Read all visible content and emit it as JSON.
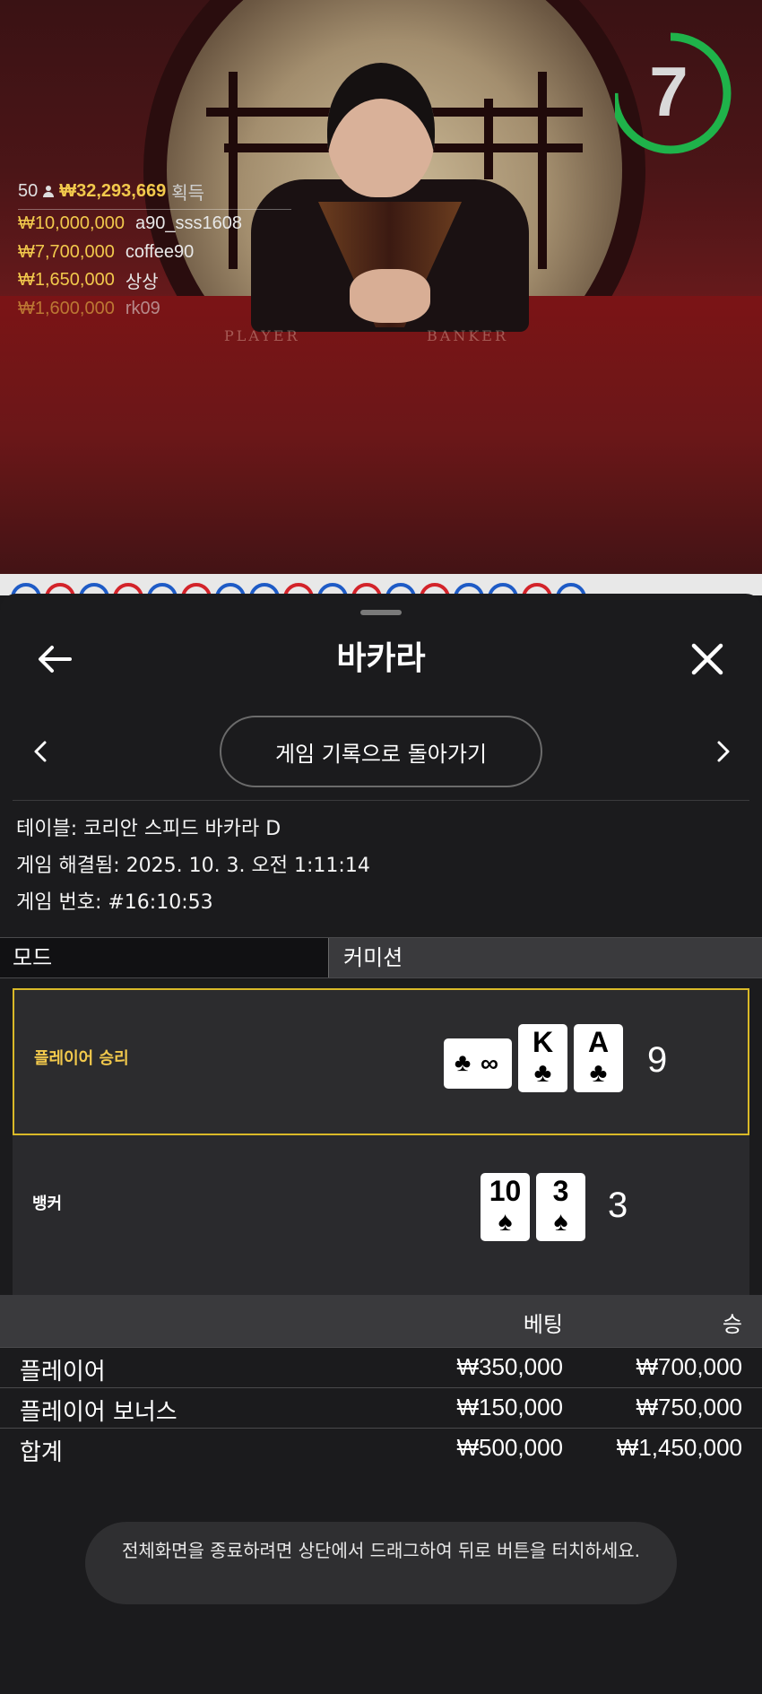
{
  "video": {
    "countdown": "7",
    "countdown_progress": 0.75,
    "felt_labels": [
      "PLAYER",
      "BANKER"
    ],
    "winners": {
      "count": "50",
      "total": "₩32,293,669",
      "label": "획득",
      "rows": [
        {
          "amount": "₩10,000,000",
          "name": "a90_sss1608"
        },
        {
          "amount": "₩7,700,000",
          "name": "coffee90"
        },
        {
          "amount": "₩1,650,000",
          "name": "상상"
        },
        {
          "amount": "₩1,600,000",
          "name": "rk09"
        }
      ]
    }
  },
  "panel": {
    "title": "바카라",
    "history_button": "게임 기록으로 돌아가기",
    "table_info": "테이블: 코리안 스피드 바카라 D",
    "resolved_info": "게임 해결됨: 2025. 10. 3. 오전 1:11:14",
    "game_number": "게임 번호: #16:10:53",
    "mode_label": "모드",
    "mode_value": "커미션",
    "player": {
      "label": "플레이어 승리",
      "score": "9",
      "cards": [
        {
          "rank": "∞",
          "suit": "♣",
          "sideways": true
        },
        {
          "rank": "K",
          "suit": "♣"
        },
        {
          "rank": "A",
          "suit": "♣"
        }
      ]
    },
    "banker": {
      "label": "뱅커",
      "score": "3",
      "cards": [
        {
          "rank": "10",
          "suit": "♠"
        },
        {
          "rank": "3",
          "suit": "♠"
        }
      ]
    },
    "bets": {
      "header_bet": "베팅",
      "header_win": "승",
      "rows": [
        {
          "label": "플레이어",
          "bet": "₩350,000",
          "win": "₩700,000"
        },
        {
          "label": "플레이어 보너스",
          "bet": "₩150,000",
          "win": "₩750,000"
        },
        {
          "label": "합계",
          "bet": "₩500,000",
          "win": "₩1,450,000"
        }
      ]
    },
    "toast": "전체화면을 종료하려면 상단에서 드래그하여 뒤로 버튼을 터치하세요."
  },
  "colors": {
    "accent_gold": "#f2c94c",
    "win_border": "#d9b928",
    "timer_green": "#1fb34a",
    "road_blue": "#1e5bc6",
    "road_red": "#d3232a"
  }
}
